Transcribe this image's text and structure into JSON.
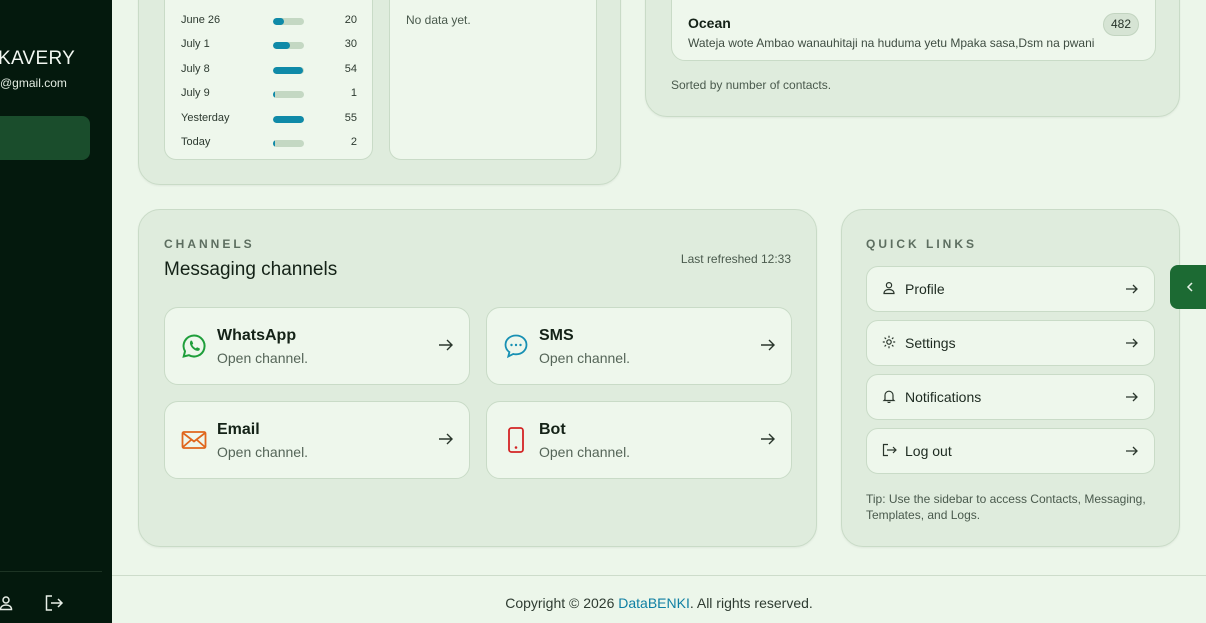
{
  "sidebar": {
    "user_name": "KAVERY",
    "user_email": "@gmail.com"
  },
  "activity": {
    "rows": [
      {
        "label": "June 26",
        "value": "20",
        "fraction": 0.37
      },
      {
        "label": "July 1",
        "value": "30",
        "fraction": 0.55
      },
      {
        "label": "July 8",
        "value": "54",
        "fraction": 0.98
      },
      {
        "label": "July 9",
        "value": "1",
        "fraction": 0.03
      },
      {
        "label": "Yesterday",
        "value": "55",
        "fraction": 1.0
      },
      {
        "label": "Today",
        "value": "2",
        "fraction": 0.05
      }
    ],
    "empty_text": "No data yet."
  },
  "groups": {
    "top_group": {
      "name": "Ocean",
      "description": "Wateja wote Ambao wanauhitaji na huduma yetu Mpaka sasa,Dsm na pwani",
      "count": "482"
    },
    "sorted_note": "Sorted by number of contacts."
  },
  "channels": {
    "eyebrow": "CHANNELS",
    "title": "Messaging channels",
    "refreshed": "Last refreshed 12:33",
    "items": [
      {
        "name": "WhatsApp",
        "sub": "Open channel.",
        "icon": "whatsapp-icon",
        "color": "#1e9e3a"
      },
      {
        "name": "SMS",
        "sub": "Open channel.",
        "icon": "sms-icon",
        "color": "#1790b3"
      },
      {
        "name": "Email",
        "sub": "Open channel.",
        "icon": "email-icon",
        "color": "#e0661d"
      },
      {
        "name": "Bot",
        "sub": "Open channel.",
        "icon": "phone-icon",
        "color": "#d32424"
      }
    ]
  },
  "quick_links": {
    "eyebrow": "QUICK LINKS",
    "items": [
      {
        "label": "Profile",
        "icon": "user-icon"
      },
      {
        "label": "Settings",
        "icon": "gear-icon"
      },
      {
        "label": "Notifications",
        "icon": "bell-icon"
      },
      {
        "label": "Log out",
        "icon": "logout-icon"
      }
    ],
    "tip": "Tip: Use the sidebar to access Contacts, Messaging, Templates, and Logs."
  },
  "footer": {
    "prefix": "Copyright © 2026 ",
    "brand": "DataBENKI",
    "suffix": ". All rights reserved."
  },
  "colors": {
    "sidebar_bg": "#04190d",
    "accent_green": "#1c6a33",
    "bar_fill": "#0f8aa8",
    "link": "#0f7fa3"
  }
}
